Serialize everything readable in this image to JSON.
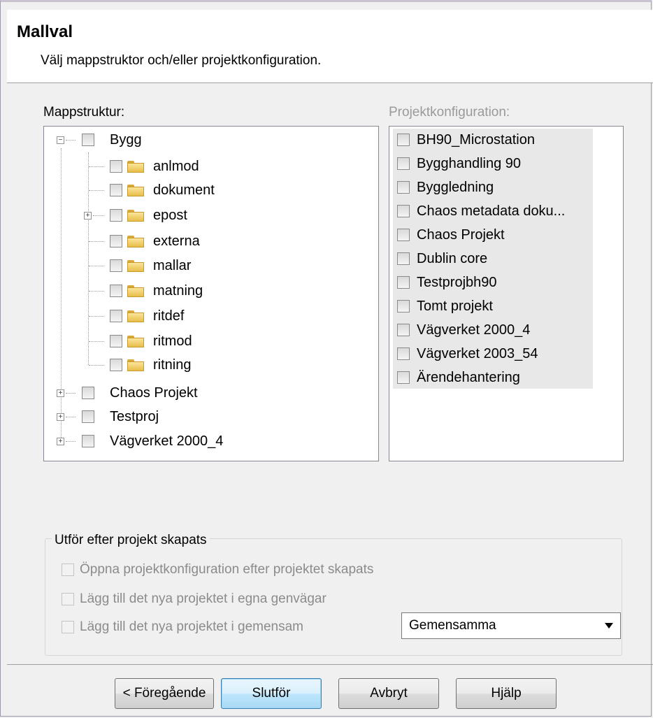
{
  "header": {
    "title": "Mallval",
    "subtitle": "Välj mappstruktor och/eller projektkonfiguration."
  },
  "mappstruktur": {
    "label": "Mappstruktur:",
    "tree": [
      {
        "label": "Bygg",
        "expanded": true,
        "children": [
          "anlmod",
          "dokument",
          "epost",
          "externa",
          "mallar",
          "matning",
          "ritdef",
          "ritmod",
          "ritning"
        ]
      },
      {
        "label": "Chaos Projekt",
        "expanded": false
      },
      {
        "label": "Testproj",
        "expanded": false
      },
      {
        "label": "Vägverket 2000_4",
        "expanded": false
      }
    ],
    "child_labels": {
      "c0": "anlmod",
      "c1": "dokument",
      "c2": "epost",
      "c3": "externa",
      "c4": "mallar",
      "c5": "matning",
      "c6": "ritdef",
      "c7": "ritmod",
      "c8": "ritning"
    },
    "root_labels": {
      "r0": "Bygg",
      "r1": "Chaos Projekt",
      "r2": "Testproj",
      "r3": "Vägverket 2000_4"
    }
  },
  "projektkonfiguration": {
    "label": "Projektkonfiguration:",
    "disabled": true,
    "items": [
      "BH90_Microstation",
      "Bygghandling 90",
      "Byggledning",
      "Chaos metadata doku...",
      "Chaos Projekt",
      "Dublin core",
      "Testprojbh90",
      "Tomt projekt",
      "Vägverket 2000_4",
      "Vägverket 2003_54",
      "Ärendehantering"
    ]
  },
  "utfor": {
    "legend": "Utför efter projekt skapats",
    "options": [
      "Öppna projektkonfiguration efter projektet skapats",
      "Lägg till det nya projektet i egna genvägar",
      "Lägg till det nya projektet i gemensam"
    ],
    "dropdown_value": "Gemensamma"
  },
  "buttons": {
    "back": "< Föregående",
    "finish": "Slutför",
    "cancel": "Avbryt",
    "help": "Hjälp"
  },
  "colors": {
    "window_bg": "#f0f0f0",
    "folder": "#f4d36b",
    "disabled_text": "#8b8b8b",
    "default_button": "#3c7fb1"
  }
}
